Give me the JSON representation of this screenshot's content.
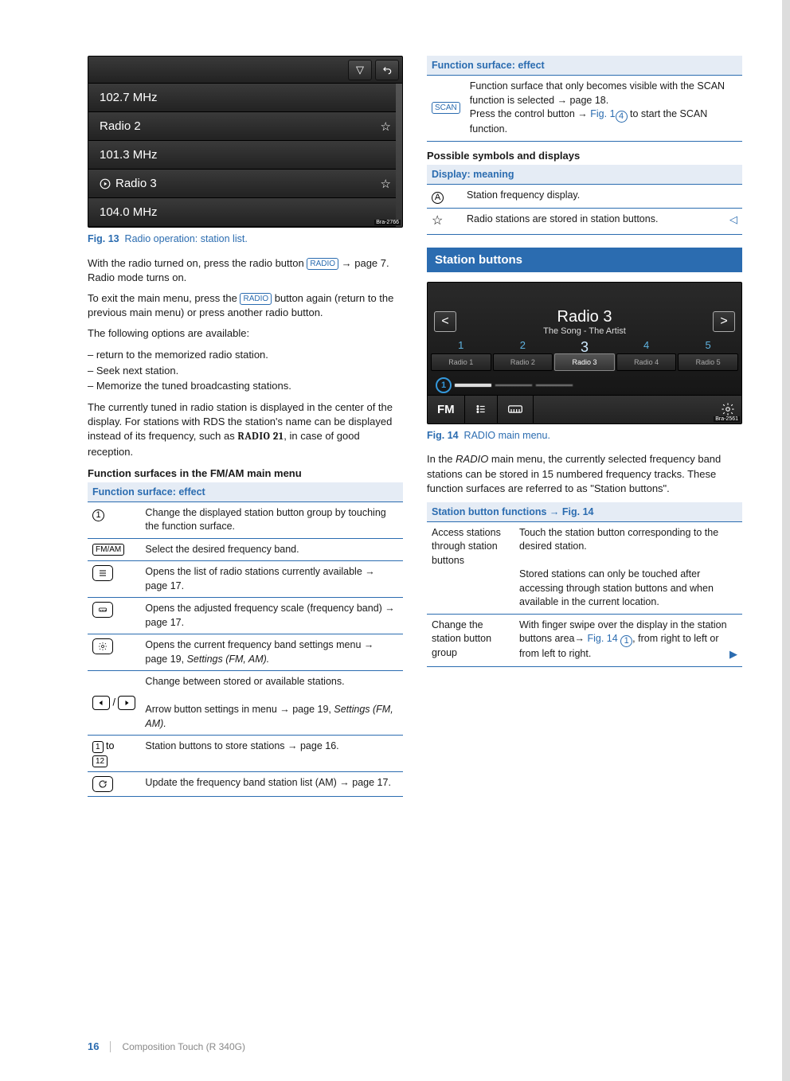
{
  "shot1": {
    "rows": [
      "102.7 MHz",
      "Radio 2",
      "101.3 MHz",
      "Radio 3",
      "104.0 MHz"
    ],
    "bra": "Bra-2766"
  },
  "fig13": {
    "num": "Fig. 13",
    "caption": "Radio operation: station list."
  },
  "col1": {
    "p1a": "With the radio turned on, press the radio button ",
    "radio": "RADIO",
    "p1b": " → page 7. Radio mode turns on.",
    "p2a": "To exit the main menu, press the ",
    "p2b": " button again (return to the previous main menu) or press another radio button.",
    "p3": "The following options are available:",
    "li1": "return to the memorized radio station.",
    "li2": "Seek next station.",
    "li3": "Memorize the tuned broadcasting stations.",
    "p4a": "The currently tuned in radio station is displayed in the center of the display. For stations with RDS the station's name can be displayed instead of its frequency, such as ",
    "radio21": "RADIO 21",
    "p4b": ", in case of good reception."
  },
  "table1": {
    "heading_menu": "Function surfaces in the FM/AM main menu",
    "header": "Function surface: effect",
    "r1": "Change the displayed station button group by touching the function surface.",
    "fmam": "FM/AM",
    "r2": "Select the desired frequency band.",
    "r3": "Opens the list of radio stations currently available → page 17.",
    "r4": "Opens the adjusted frequency scale (frequency band) → page 17.",
    "r5a": "Opens the current frequency band settings menu → page 19, ",
    "r5b": "Settings (FM, AM).",
    "r6a": "Change between stored or available stations.",
    "r6b1": "Arrow button settings in menu → page 19, ",
    "r6b2": "Settings (FM, AM).",
    "r7_to": " to",
    "r7": "Station buttons to store stations → page 16.",
    "r8": "Update the frequency band station list (AM) → page 17."
  },
  "table2": {
    "header": "Function surface: effect",
    "scan": "SCAN",
    "r1a": "Function surface that only becomes visible with the SCAN function is selected → page 18.",
    "r1b1": "Press the control button → ",
    "r1b_fig": "Fig. 1",
    "r1b2": " to start the SCAN function."
  },
  "possible": "Possible symbols and displays",
  "table3": {
    "header": "Display: meaning",
    "rA": "Station frequency display.",
    "rStar": "Radio stations are stored in station buttons."
  },
  "section": "Station buttons",
  "shot2": {
    "name": "Radio 3",
    "song": "The Song - The Artist",
    "presets": [
      {
        "num": "1",
        "label": "Radio 1"
      },
      {
        "num": "2",
        "label": "Radio 2"
      },
      {
        "num": "3",
        "label": "Radio 3"
      },
      {
        "num": "4",
        "label": "Radio 4"
      },
      {
        "num": "5",
        "label": "Radio 5"
      }
    ],
    "circ1": "1",
    "fm": "FM",
    "bra": "Bra-2561"
  },
  "fig14": {
    "num": "Fig. 14",
    "caption": "RADIO main menu."
  },
  "col2p": {
    "p1a": "In the ",
    "radio_it": "RADIO",
    "p1b": " main menu, the currently selected frequency band stations can be stored in 15 numbered frequency tracks. These function surfaces are referred to as \"Station buttons\"."
  },
  "table4": {
    "header": "Station button functions → ",
    "header_fig": "Fig. 14",
    "r1_name": "Access stations through station buttons",
    "r1a": "Touch the station button corresponding to the desired station.",
    "r1b": "Stored stations can only be touched after accessing through station buttons and when available in the current location.",
    "r2_name": "Change the station button group",
    "r2a": "With finger swipe over the display in the station buttons area→ ",
    "r2_fig": "Fig. 14 ",
    "r2b": ", from right to left or from left to right."
  },
  "footer": {
    "page": "16",
    "title": "Composition Touch (R 340G)"
  }
}
